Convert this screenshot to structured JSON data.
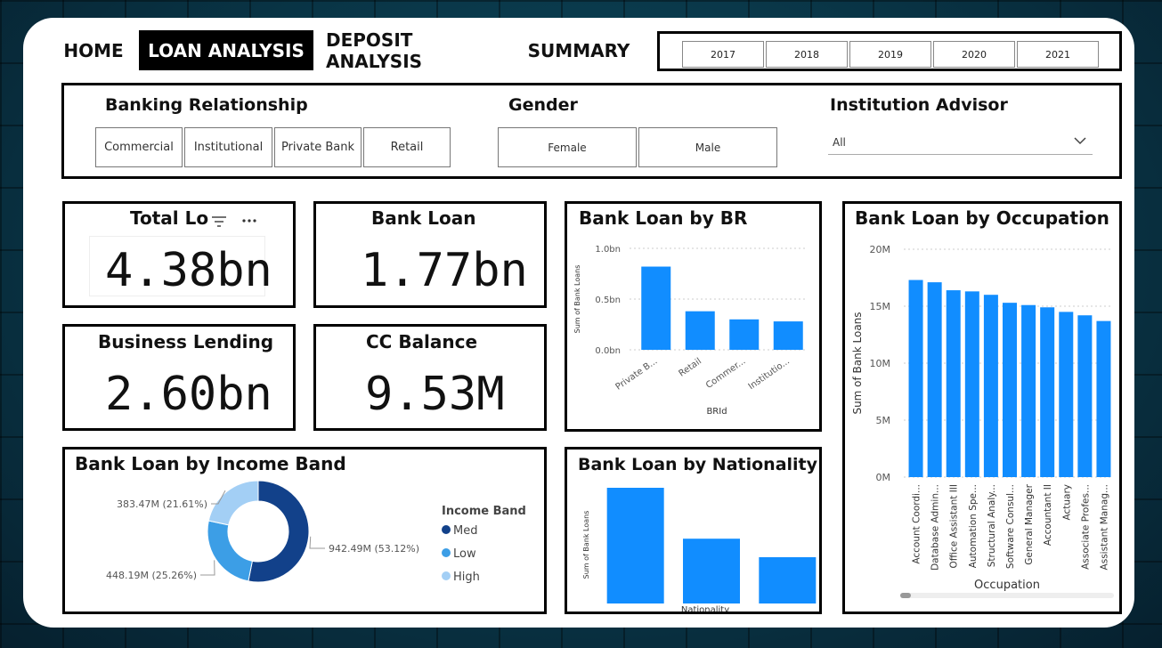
{
  "nav": {
    "tabs": [
      "HOME",
      "LOAN ANALYSIS",
      "DEPOSIT ANALYSIS",
      "SUMMARY"
    ],
    "active": "LOAN ANALYSIS"
  },
  "years": [
    "2017",
    "2018",
    "2019",
    "2020",
    "2021"
  ],
  "slicers": {
    "banking_relationship": {
      "title": "Banking Relationship",
      "options": [
        "Commercial",
        "Institutional",
        "Private Bank",
        "Retail"
      ]
    },
    "gender": {
      "title": "Gender",
      "options": [
        "Female",
        "Male"
      ]
    },
    "institution_advisor": {
      "title": "Institution Advisor",
      "value": "All"
    }
  },
  "kpis": {
    "total_loan": {
      "title": "Total Lo",
      "value": "4.38bn"
    },
    "bank_loan": {
      "title": "Bank Loan",
      "value": "1.77bn"
    },
    "business_lending": {
      "title": "Business Lending",
      "value": "2.60bn"
    },
    "cc_balance": {
      "title": "CC Balance",
      "value": "9.53M"
    }
  },
  "colors": {
    "accent": "#118dff",
    "dark_blue": "#12418a",
    "mid_blue": "#3c9ee6",
    "light_blue": "#a3cff5"
  },
  "chart_data": [
    {
      "id": "br",
      "type": "bar",
      "title": "Bank Loan by BR",
      "categories": [
        "Private B...",
        "Retail",
        "Commer...",
        "Institutio..."
      ],
      "values": [
        0.82,
        0.38,
        0.3,
        0.28
      ],
      "yticks": [
        "0.0bn",
        "0.5bn",
        "1.0bn"
      ],
      "ylim": [
        0,
        1.0
      ],
      "xlabel": "BRId",
      "ylabel": "Sum of Bank Loans",
      "grid": true
    },
    {
      "id": "occupation",
      "type": "bar",
      "title": "Bank Loan by Occupation",
      "categories": [
        "Account Coordi...",
        "Database Admin...",
        "Office Assistant III",
        "Automation Spe...",
        "Structural Analy...",
        "Software Consul...",
        "General Manager",
        "Accountant II",
        "Actuary",
        "Associate Profes...",
        "Assistant Manag..."
      ],
      "values": [
        17.3,
        17.1,
        16.4,
        16.3,
        16.0,
        15.3,
        15.1,
        14.9,
        14.5,
        14.2,
        13.7
      ],
      "yticks": [
        "0M",
        "5M",
        "10M",
        "15M",
        "20M"
      ],
      "ylim": [
        0,
        20
      ],
      "xlabel": "Occupation",
      "ylabel": "Sum of Bank Loans",
      "grid": true
    },
    {
      "id": "income",
      "type": "pie",
      "title": "Bank Loan by Income Band",
      "legend_title": "Income Band",
      "slices": [
        {
          "name": "Med",
          "value": 942.49,
          "label": "942.49M (53.12%)",
          "color": "#12418a"
        },
        {
          "name": "Low",
          "value": 448.19,
          "label": "448.19M (25.26%)",
          "color": "#3c9ee6"
        },
        {
          "name": "High",
          "value": 383.47,
          "label": "383.47M (21.61%)",
          "color": "#a3cff5"
        }
      ],
      "legend_position": "right"
    },
    {
      "id": "nationality",
      "type": "bar",
      "title": "Bank Loan by Nationality",
      "categories": [
        "",
        "",
        ""
      ],
      "values": [
        1.0,
        0.56,
        0.4
      ],
      "xlabel": "Nationality",
      "ylabel": "Sum of Bank Loans"
    }
  ]
}
